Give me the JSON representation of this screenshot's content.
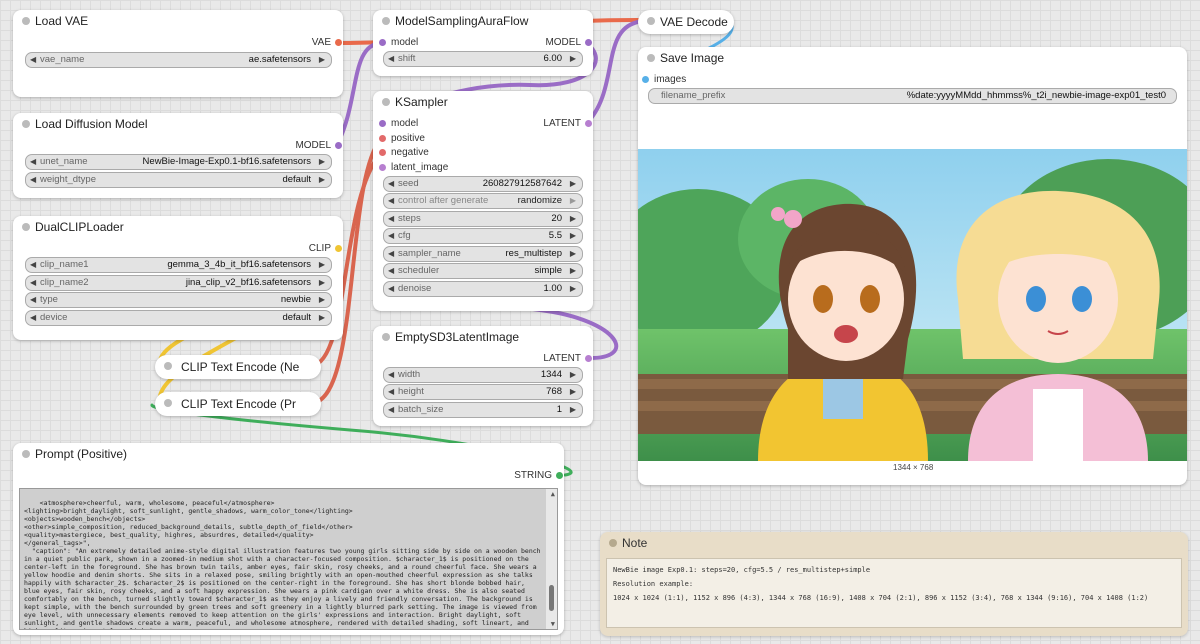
{
  "colors": {
    "vae": "#e96a4b",
    "model": "#9a6cc6",
    "clip": "#f0c534",
    "latent": "#b77fd0",
    "image": "#57b0e8",
    "string": "#3fae5b",
    "conditioning": "#e26a6a"
  },
  "load_vae": {
    "title": "Load VAE",
    "out": "VAE",
    "widget_label": "vae_name",
    "widget_value": "ae.safetensors"
  },
  "load_model": {
    "title": "Load Diffusion Model",
    "out": "MODEL",
    "w1_label": "unet_name",
    "w1_value": "NewBie-Image-Exp0.1-bf16.safetensors",
    "w2_label": "weight_dtype",
    "w2_value": "default"
  },
  "dual_clip": {
    "title": "DualCLIPLoader",
    "out": "CLIP",
    "w1_label": "clip_name1",
    "w1_value": "gemma_3_4b_it_bf16.safetensors",
    "w2_label": "clip_name2",
    "w2_value": "jina_clip_v2_bf16.safetensors",
    "w3_label": "type",
    "w3_value": "newbie",
    "w4_label": "device",
    "w4_value": "default"
  },
  "clip_neg": {
    "title": "CLIP Text Encode (Ne"
  },
  "clip_pos": {
    "title": "CLIP Text Encode (Pr"
  },
  "model_sampling": {
    "title": "ModelSamplingAuraFlow",
    "in": "model",
    "out": "MODEL",
    "w_label": "shift",
    "w_value": "6.00"
  },
  "ksampler": {
    "title": "KSampler",
    "out": "LATENT",
    "inputs": [
      "model",
      "positive",
      "negative",
      "latent_image"
    ],
    "seed_label": "seed",
    "seed_value": "260827912587642",
    "cag_label": "control after generate",
    "cag_value": "randomize",
    "steps_label": "steps",
    "steps_value": "20",
    "cfg_label": "cfg",
    "cfg_value": "5.5",
    "sampler_label": "sampler_name",
    "sampler_value": "res_multistep",
    "scheduler_label": "scheduler",
    "scheduler_value": "simple",
    "denoise_label": "denoise",
    "denoise_value": "1.00"
  },
  "empty_latent": {
    "title": "EmptySD3LatentImage",
    "out": "LATENT",
    "w1_label": "width",
    "w1_value": "1344",
    "w2_label": "height",
    "w2_value": "768",
    "w3_label": "batch_size",
    "w3_value": "1"
  },
  "vae_decode": {
    "title": "VAE Decode"
  },
  "save_image": {
    "title": "Save Image",
    "in": "images",
    "prefix_label": "filename_prefix",
    "prefix_value": "%date:yyyyMMdd_hhmmss%_t2i_newbie-image-exp01_test0",
    "image_size": "1344 × 768"
  },
  "prompt_node": {
    "title": "Prompt (Positive)",
    "out": "STRING",
    "text": "<atmosphere>cheerful, warm, wholesome, peaceful</atmosphere>\n<lighting>bright_daylight, soft_sunlight, gentle_shadows, warm_color_tone</lighting>\n<objects>wooden_bench</objects>\n<other>simple_composition, reduced_background_details, subtle_depth_of_field</other>\n<quality>mastergiece, best_quality, highres, absurdres, detailed</quality>\n</general_tags>\",\n  \"caption\": \"An extremely detailed anime-style digital illustration features two young girls sitting side by side on a wooden bench in a quiet public park, shown in a zoomed-in medium shot with a character-focused composition. $character_1$ is positioned on the center-left in the foreground. She has brown twin tails, amber eyes, fair skin, rosy cheeks, and a round cheerful face. She wears a yellow hoodie and denim shorts. She sits in a relaxed pose, smiling brightly with an open-mouthed cheerful expression as she talks happily with $character_2$. $character_2$ is positioned on the center-right in the foreground. She has short blonde bobbed hair, blue eyes, fair skin, rosy cheeks, and a soft happy expression. She wears a pink cardigan over a white dress. She is also seated comfortably on the bench, turned slightly toward $character_1$ as they enjoy a lively and friendly conversation. The background is kept simple, with the bench surrounded by green trees and soft greenery in a lightly blurred park setting. The image is viewed from eye level, with unnecessary elements removed to keep attention on the girls' expressions and interaction. Bright daylight, soft sunlight, and gentle shadows create a warm, peaceful, and wholesome atmosphere, rendered with detailed shading, soft lineart, and high-quality anime-style polish.\"\n  }\n}"
  },
  "note": {
    "title": "Note",
    "line1": "NewBie image Exp0.1: steps=20, cfg=5.5 / res_multistep+simple",
    "line2": "Resolution example:",
    "line3": "1024 x 1024 (1:1), 1152 x 896 (4:3), 1344 x 768 (16:9), 1408 x 704 (2:1), 896 x 1152 (3:4), 768 x 1344 (9:16), 704 x 1408 (1:2)"
  }
}
